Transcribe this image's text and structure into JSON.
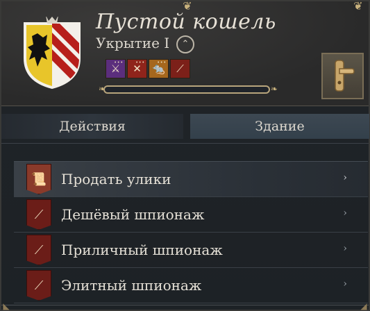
{
  "header": {
    "title": "Пустой кошель",
    "subtitle": "Укрытие I",
    "rank_icon": "chevron-up-circle",
    "crest": {
      "description_icon": "heraldic-shield-eagle",
      "colors": {
        "gold": "#e8c52a",
        "red": "#b71f1b",
        "white": "#f3f0ea",
        "black": "#111111"
      }
    },
    "status_icons": [
      {
        "name": "sword-icon",
        "glyph": "⚔",
        "color": "#5b2e7d",
        "dots": "•••"
      },
      {
        "name": "crossed-tools-icon",
        "glyph": "✕",
        "color": "#8f241b",
        "dots": "•••"
      },
      {
        "name": "rat-icon",
        "glyph": "🐀",
        "color": "#a5671d",
        "dots": "•••"
      },
      {
        "name": "telescope-icon",
        "glyph": "⟋",
        "color": "#7c2019",
        "dots": ""
      }
    ],
    "progress": 0.0,
    "door_button_icon": "door-handle-icon"
  },
  "tabs": [
    {
      "label": "Действия",
      "active": true
    },
    {
      "label": "Здание",
      "active": false
    }
  ],
  "actions": [
    {
      "label": "Продать улики",
      "icon": "scroll-icon",
      "glyph": "📜",
      "arrow": "›"
    },
    {
      "label": "Дешёвый шпионаж",
      "icon": "telescope-icon",
      "glyph": "⟋",
      "arrow": "›"
    },
    {
      "label": "Приличный шпионаж",
      "icon": "telescope-icon",
      "glyph": "⟋",
      "arrow": "›"
    },
    {
      "label": "Элитный шпионаж",
      "icon": "telescope-icon",
      "glyph": "⟋",
      "arrow": "›"
    }
  ]
}
